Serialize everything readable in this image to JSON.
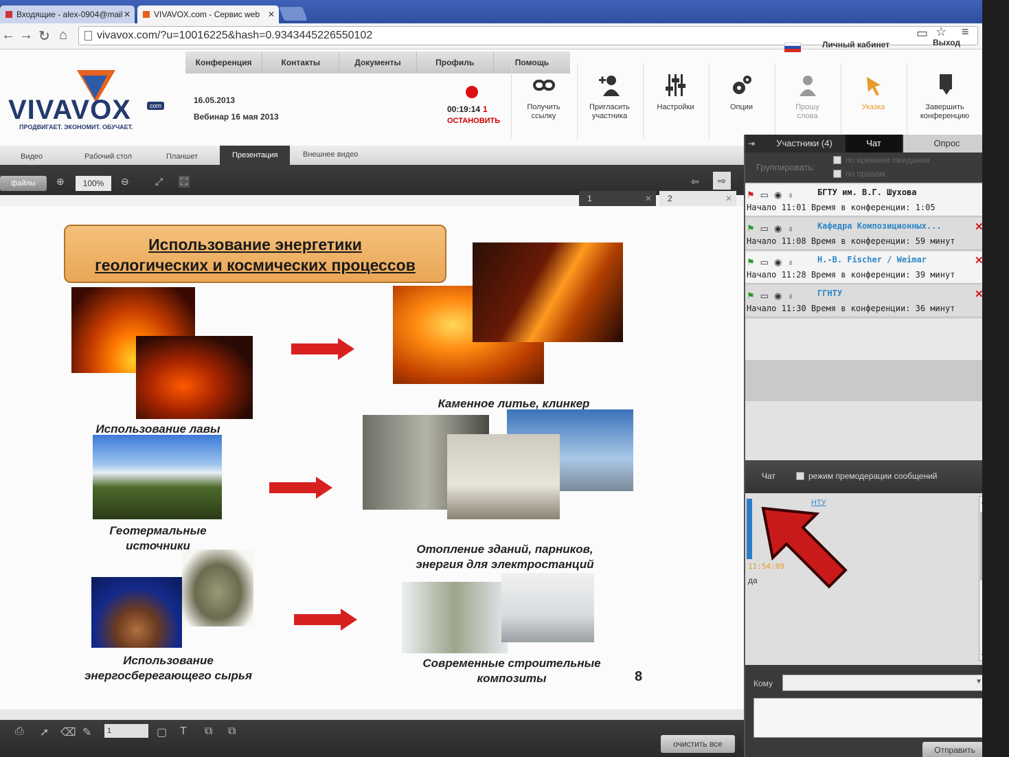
{
  "browser": {
    "tabs": [
      {
        "label": "Входящие - alex-0904@mail",
        "active": false
      },
      {
        "label": "VIVAVOX.com - Сервис web",
        "active": true
      }
    ],
    "url": "vivavox.com/?u=10016225&hash=0.9343445226550102"
  },
  "header": {
    "menu": [
      "Конференция",
      "Контакты",
      "Документы",
      "Профиль",
      "Помощь"
    ],
    "cabinet_link": "Личный кабинет",
    "logout_link": "Выход",
    "logo_word": "VIVAVOX",
    "logo_suffix": "com",
    "logo_slogan": "ПРОДВИГАЕТ. ЭКОНОМИТ. ОБУЧАЕТ.",
    "date": "16.05.2013",
    "event": "Вебинар 16 мая 2013",
    "timer": "00:19:14",
    "timer_count": "1",
    "stop_label": "ОСТАНОВИТЬ",
    "tools": [
      {
        "line1": "Получить",
        "line2": "ссылку",
        "icon": "link-icon"
      },
      {
        "line1": "Пригласить",
        "line2": "участника",
        "icon": "add-user-icon"
      },
      {
        "line1": "Настройки",
        "line2": "",
        "icon": "sliders-icon"
      },
      {
        "line1": "Опции",
        "line2": "",
        "icon": "gears-icon"
      },
      {
        "line1": "Прошу",
        "line2": "слова",
        "icon": "request-word-icon"
      },
      {
        "line1": "Указка",
        "line2": "",
        "icon": "pointer-icon"
      },
      {
        "line1": "Завершить",
        "line2": "конференцию",
        "icon": "end-conference-icon"
      }
    ]
  },
  "viewtabs": [
    "Видео",
    "Рабочий стол",
    "Планшет",
    "Презентация",
    "Внешнее видео"
  ],
  "toolbar": {
    "files": "файлы",
    "zoom": "100%"
  },
  "pages": [
    "1",
    "2"
  ],
  "slide": {
    "title_line1": "Использование энергетики",
    "title_line2": "геологических и космических процессов",
    "cap_lava": "Использование лавы",
    "cap_casting": "Каменное литье, клинкер",
    "cap_geo1": "Геотермальные",
    "cap_geo2": "источники",
    "cap_heat1": "Отопление зданий, парников,",
    "cap_heat2": "энергия для электростанций",
    "cap_raw1": "Использование",
    "cap_raw2": "энергосберегающего сырья",
    "cap_comp1": "Современные строительные",
    "cap_comp2": "композиты",
    "number": "8"
  },
  "draw": {
    "clear": "очистить все",
    "size": "1"
  },
  "panel": {
    "tab_participants": "Участники (4)",
    "tab_chat": "Чат",
    "tab_poll": "Опрос",
    "group_label": "Группировать:",
    "group_opt1": "по времени ожидания",
    "group_opt2": "по правам",
    "participants": [
      {
        "name": "БГТУ им. В.Г. Шухова",
        "start": "Начало 11:01",
        "time": "Время в конференции: 1:05"
      },
      {
        "name": "Кафедра Композиционных...",
        "start": "Начало 11:08",
        "time": "Время в конференции: 59 минут"
      },
      {
        "name": "H.-B. Fischer / Weimar",
        "start": "Начало 11:28",
        "time": "Время в конференции: 39 минут"
      },
      {
        "name": "ГГНТУ",
        "start": "Начало 11:30",
        "time": "Время в конференции: 36 минут"
      }
    ],
    "chat_label": "Чат",
    "premod_label": "режим премодерации сообщений",
    "chat_link": "НТУ",
    "chat_time": "11:54:09",
    "chat_msg": "да",
    "to_label": "Кому",
    "send": "Отправить"
  }
}
